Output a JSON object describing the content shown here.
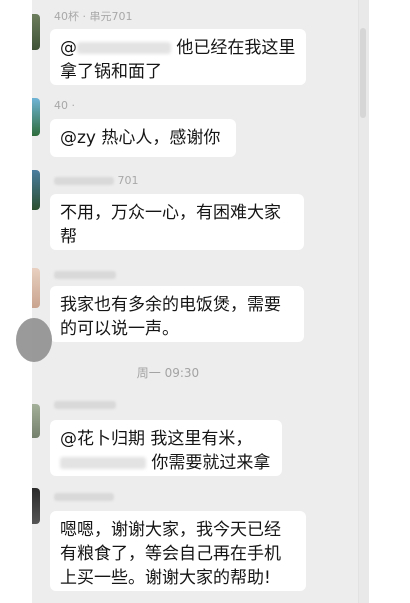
{
  "colors": {
    "chat_background": "#ededed",
    "bubble_background": "#ffffff",
    "message_text": "#151515",
    "meta_text": "#a3a3a3"
  },
  "scroll": {
    "thumb_fraction": 0.15
  },
  "messages": [
    {
      "name_partial": "40杯 · 串元701",
      "line1_tail": "他已经在我这里",
      "line2": "拿了锅和面了"
    },
    {
      "name_partial": "40 ·",
      "text": "@zy  热心人，感谢你"
    },
    {
      "name_partial": "701",
      "line1": "不用，万众一心，有困难大家",
      "line2": "帮"
    },
    {
      "name_partial": "",
      "line1": "我家也有多余的电饭煲，需要",
      "line2": "的可以说一声。"
    },
    {
      "line1": "@花卜归期  我这里有米，",
      "line2_tail": "你需要就过来拿"
    },
    {
      "line1": "嗯嗯，谢谢大家，我今天已经",
      "line2": "有粮食了，等会自己再在手机",
      "line3": "上买一些。谢谢大家的帮助!"
    }
  ],
  "timestamp": "周一 09:30"
}
